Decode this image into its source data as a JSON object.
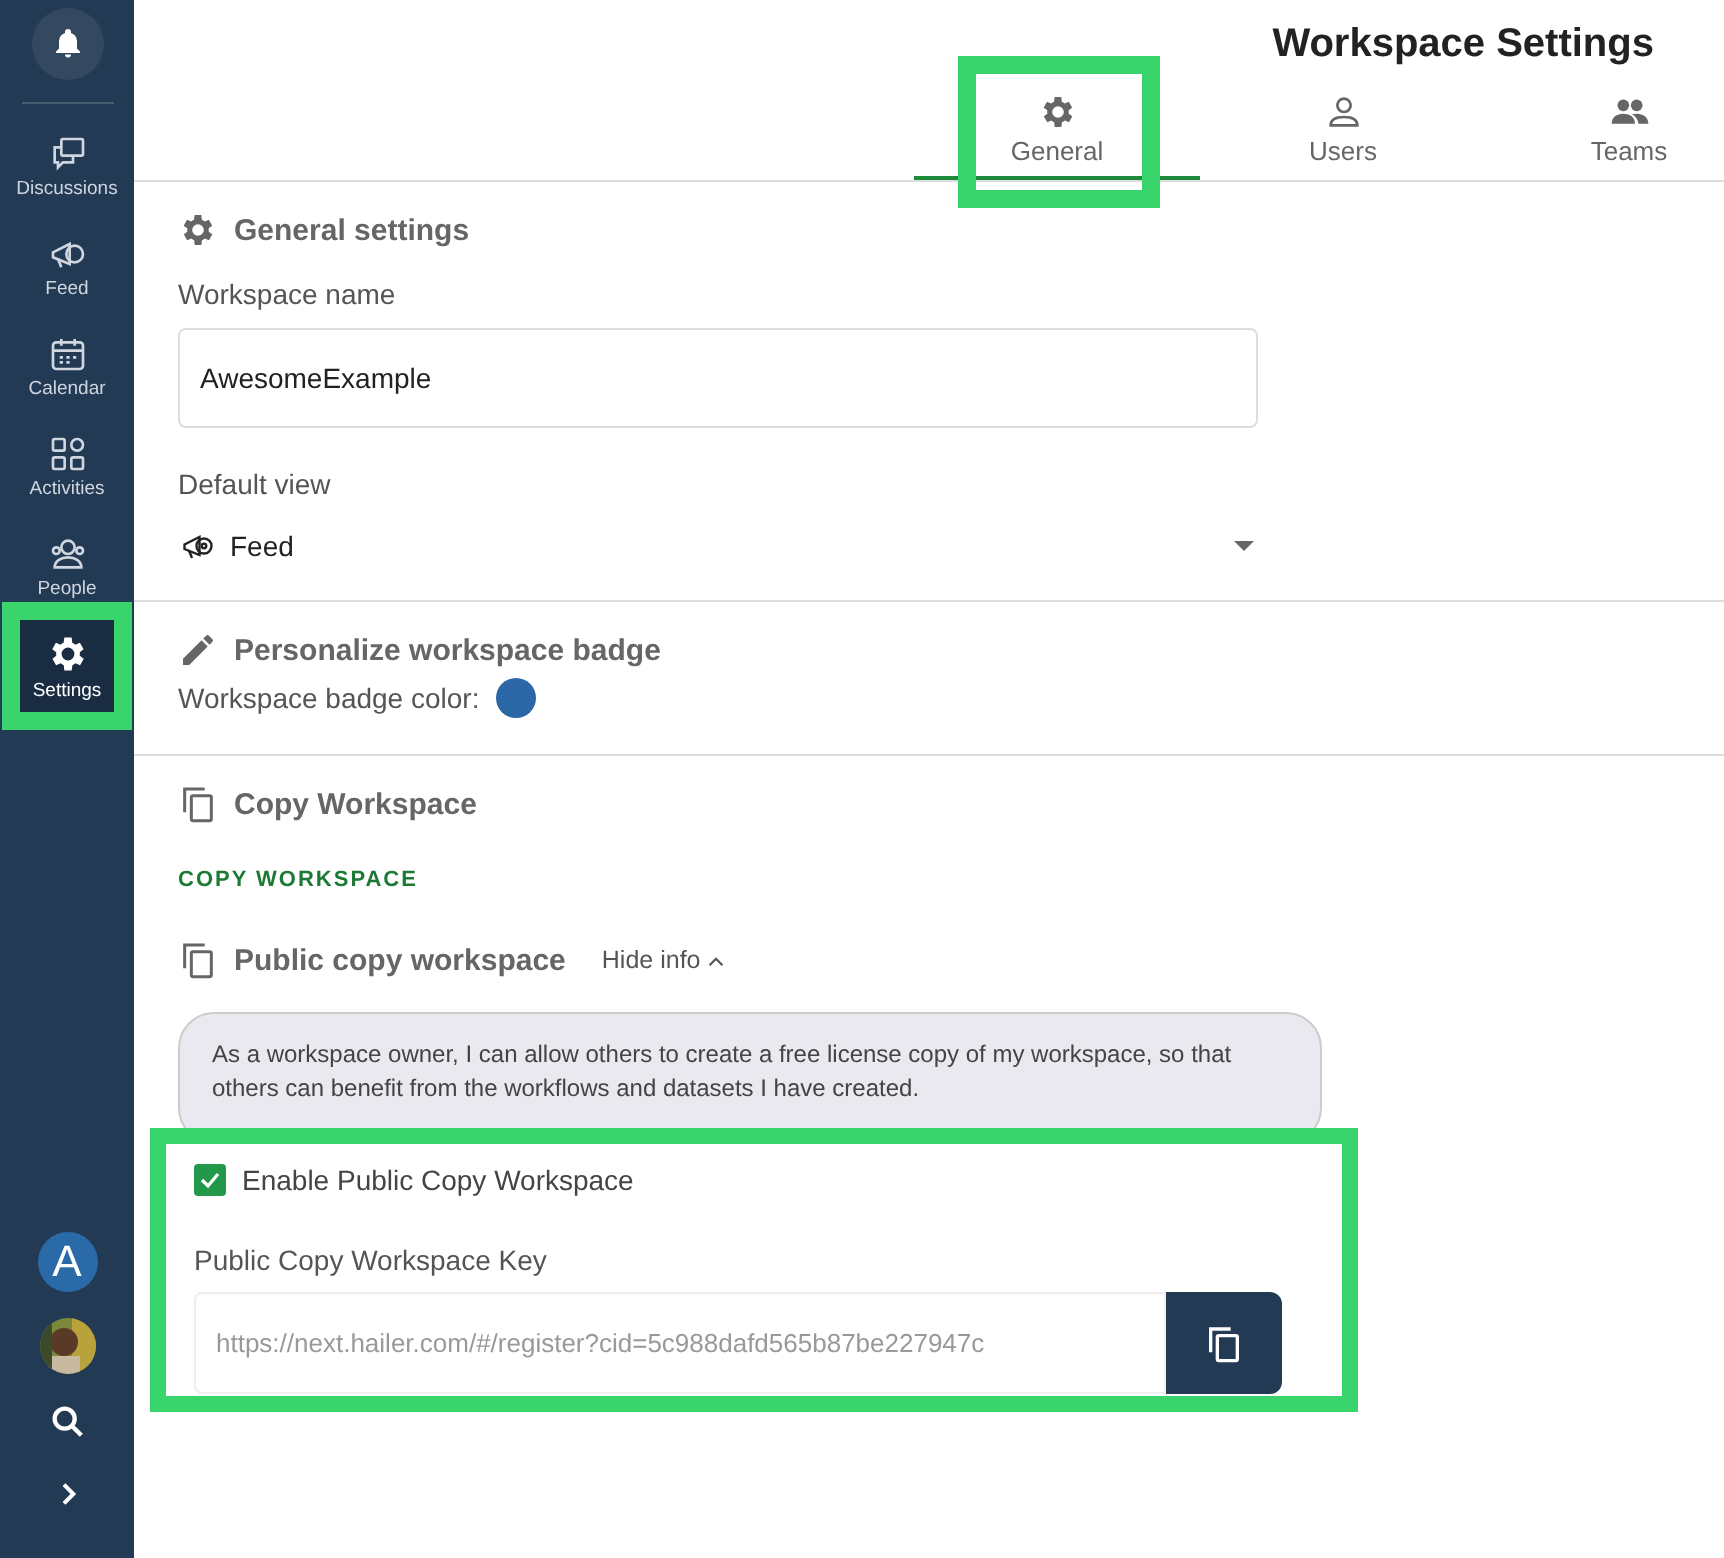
{
  "sidebar": {
    "items": [
      {
        "label": "Discussions",
        "kind": "discussions",
        "selected": false,
        "highlighted": false
      },
      {
        "label": "Feed",
        "kind": "feed",
        "selected": false,
        "highlighted": false
      },
      {
        "label": "Calendar",
        "kind": "calendar",
        "selected": false,
        "highlighted": false
      },
      {
        "label": "Activities",
        "kind": "activities",
        "selected": false,
        "highlighted": false
      },
      {
        "label": "People",
        "kind": "people",
        "selected": false,
        "highlighted": false
      },
      {
        "label": "Settings",
        "kind": "settings",
        "selected": true,
        "highlighted": true
      }
    ],
    "account_initial": "A"
  },
  "title": "Workspace Settings",
  "tabs": [
    {
      "label": "General",
      "kind": "general",
      "selected": true,
      "highlighted": true
    },
    {
      "label": "Users",
      "kind": "users",
      "selected": false,
      "highlighted": false
    },
    {
      "label": "Teams",
      "kind": "teams",
      "selected": false,
      "highlighted": false
    }
  ],
  "general": {
    "heading": "General settings",
    "name_label": "Workspace name",
    "name_value": "AwesomeExample",
    "view_label": "Default view",
    "view_value": "Feed"
  },
  "badge": {
    "heading": "Personalize workspace badge",
    "color_label": "Workspace badge color:",
    "color": "#2b66a6"
  },
  "copy": {
    "heading": "Copy Workspace",
    "link": "COPY WORKSPACE",
    "public_heading": "Public copy workspace",
    "hide_info": "Hide info",
    "info": "As a workspace owner, I can allow others to create a free license copy of my workspace, so that others can benefit from the workflows and datasets I have created.",
    "enable_label": "Enable Public Copy Workspace",
    "enable_checked": true,
    "highlighted": true,
    "key_label": "Public Copy Workspace Key",
    "key_value": "https://next.hailer.com/#/register?cid=5c988dafd565b87be227947c"
  }
}
